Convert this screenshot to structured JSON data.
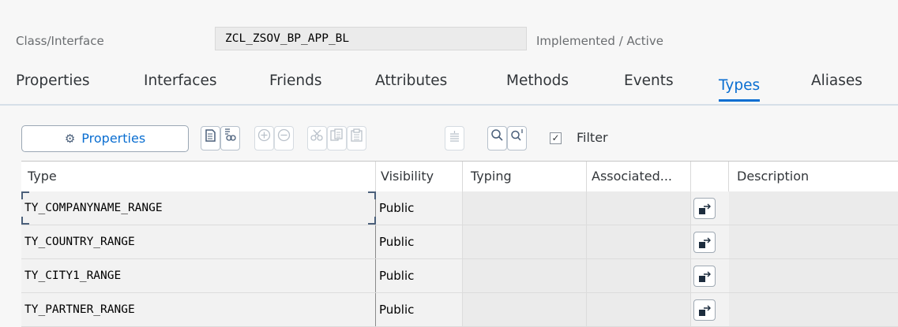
{
  "header": {
    "class_label": "Class/Interface",
    "class_name": "ZCL_ZSOV_BP_APP_BL",
    "status": "Implemented / Active"
  },
  "tabs": [
    {
      "label": "Properties"
    },
    {
      "label": "Interfaces"
    },
    {
      "label": "Friends"
    },
    {
      "label": "Attributes"
    },
    {
      "label": "Methods"
    },
    {
      "label": "Events"
    },
    {
      "label": "Types",
      "active": true
    },
    {
      "label": "Aliases"
    }
  ],
  "toolbar": {
    "properties_label": "Properties",
    "filter_label": "Filter",
    "filter_checked": true,
    "icons": [
      "document-icon",
      "where-used-icon",
      "insert-row-icon",
      "delete-row-icon",
      "cut-icon",
      "copy-icon",
      "paste-icon",
      "align-icon",
      "find-icon",
      "find-next-icon"
    ]
  },
  "table": {
    "columns": [
      "Type",
      "Visibility",
      "Typing",
      "Associated...",
      "",
      "Description"
    ],
    "rows": [
      {
        "type": "TY_COMPANYNAME_RANGE",
        "visibility": "Public",
        "typing": "",
        "associated": "",
        "description": ""
      },
      {
        "type": "TY_COUNTRY_RANGE",
        "visibility": "Public",
        "typing": "",
        "associated": "",
        "description": ""
      },
      {
        "type": "TY_CITY1_RANGE",
        "visibility": "Public",
        "typing": "",
        "associated": "",
        "description": ""
      },
      {
        "type": "TY_PARTNER_RANGE",
        "visibility": "Public",
        "typing": "",
        "associated": "",
        "description": ""
      }
    ]
  },
  "colors": {
    "accent": "#0a6ed1",
    "background": "#f7f7f7",
    "row_background": "#f2f2f2"
  }
}
